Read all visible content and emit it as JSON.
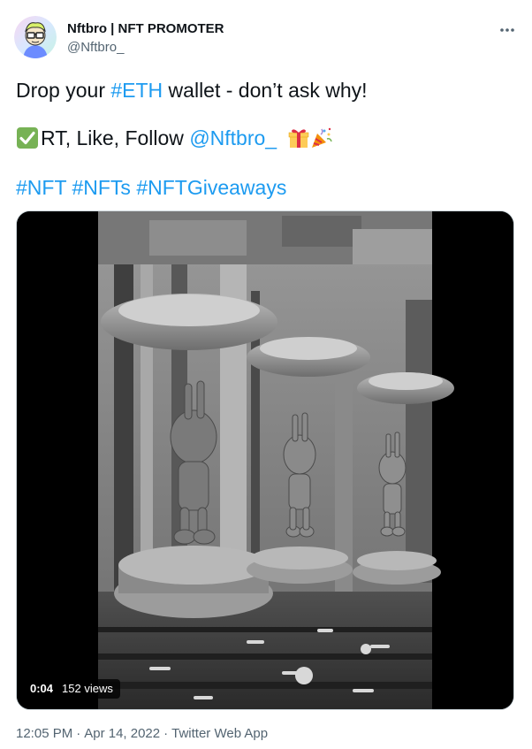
{
  "author": {
    "display_name": "Nftbro | NFT PROMOTER",
    "handle": "@Nftbro_"
  },
  "tweet": {
    "line1": {
      "prefix": "Drop your ",
      "hashtag": "#ETH",
      "suffix": " wallet - don’t ask why!"
    },
    "line2": {
      "prefix": "RT, Like, Follow ",
      "mention": "@Nftbro_"
    },
    "hashtags": [
      "#NFT",
      "#NFTs",
      "#NFTGiveaways"
    ]
  },
  "video": {
    "time": "0:04",
    "views": "152 views"
  },
  "meta": {
    "time": "12:05 PM",
    "date": "Apr 14, 2022",
    "source": "Twitter Web App",
    "separator": "·"
  },
  "icons": {
    "more": "more-dots-icon",
    "check": "white-check-mark-emoji",
    "gift": "gift-emoji",
    "party": "party-popper-emoji"
  },
  "colors": {
    "link": "#1d9bf0",
    "text": "#0f1419",
    "secondary": "#536471",
    "check_green": "#77b255"
  }
}
